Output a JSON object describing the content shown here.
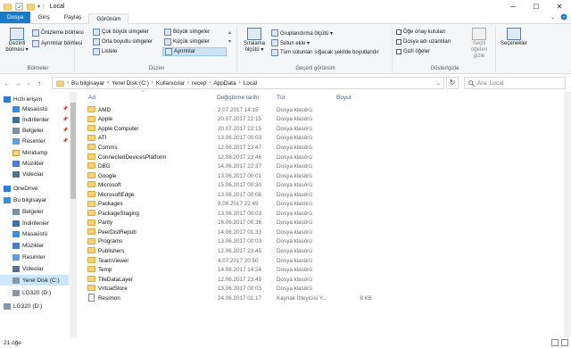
{
  "window": {
    "title": "Local",
    "controls": [
      "─",
      "☐",
      "✕"
    ]
  },
  "ribbon_tabs": {
    "file": "Dosya",
    "home": "Giriş",
    "share": "Paylaş",
    "view": "Görünüm"
  },
  "ribbon": {
    "panes": {
      "nav_pane": "Gezinti bölmesi ▾",
      "preview": "Önizleme bölmesi",
      "details": "Ayrıntılar bölmesi",
      "label": "Bölmeler"
    },
    "layout": {
      "extra_large": "Çok büyük simgeler",
      "large": "Büyük simgeler",
      "medium": "Orta boyutlu simgeler",
      "small": "Küçük simgeler",
      "list": "Listele",
      "details": "Ayrıntılar",
      "label": "Düzen"
    },
    "current_view": {
      "sort": "Sıralama ölçütü ▾",
      "group": "Gruplandırma ölçütü ▾",
      "add_columns": "Sütun ekle ▾",
      "fit_columns": "Tüm sütunları sığacak şekilde boyutlandır",
      "label": "Geçerli görünüm"
    },
    "show_hide": {
      "checkboxes": "Öğe onay kutuları",
      "extensions": "Dosya adı uzantıları",
      "hidden": "Gizli öğeler",
      "hide_selected": "Seçili öğeleri gizle",
      "label": "Göster/gizle"
    },
    "options": "Seçenekler"
  },
  "address": {
    "crumbs": [
      "Bu bilgisayar",
      "Yerel Disk (C:)",
      "Kullanıcılar",
      "recep",
      "AppData",
      "Local"
    ],
    "search_placeholder": "Ara: Local"
  },
  "nav": {
    "items": [
      {
        "label": "Hızlı erişim",
        "icon": "star-icon",
        "level": 0,
        "pinned": false
      },
      {
        "label": "Masaüstü",
        "icon": "desktop-icon",
        "level": 1,
        "pinned": true
      },
      {
        "label": "İndirilenler",
        "icon": "download-icon",
        "level": 1,
        "pinned": true
      },
      {
        "label": "Belgeler",
        "icon": "documents-icon",
        "level": 1,
        "pinned": true
      },
      {
        "label": "Resimler",
        "icon": "pictures-icon",
        "level": 1,
        "pinned": true
      },
      {
        "label": "Minidump",
        "icon": "folder-icon",
        "level": 1,
        "pinned": false
      },
      {
        "label": "Müzikler",
        "icon": "music-icon",
        "level": 1,
        "pinned": false
      },
      {
        "label": "Videolar",
        "icon": "videos-icon",
        "level": 1,
        "pinned": false
      },
      {
        "label": "OneDrive",
        "icon": "onedrive-icon",
        "level": 0,
        "pinned": false
      },
      {
        "label": "Bu bilgisayar",
        "icon": "computer-icon",
        "level": 0,
        "pinned": false
      },
      {
        "label": "Belgeler",
        "icon": "documents-icon",
        "level": 1,
        "pinned": false
      },
      {
        "label": "İndirilenler",
        "icon": "download-icon",
        "level": 1,
        "pinned": false
      },
      {
        "label": "Masaüstü",
        "icon": "desktop-icon",
        "level": 1,
        "pinned": false
      },
      {
        "label": "Müzikler",
        "icon": "music-icon",
        "level": 1,
        "pinned": false
      },
      {
        "label": "Resimler",
        "icon": "pictures-icon",
        "level": 1,
        "pinned": false
      },
      {
        "label": "Videolar",
        "icon": "videos-icon",
        "level": 1,
        "pinned": false
      },
      {
        "label": "Yerel Disk (C:)",
        "icon": "drive-icon",
        "level": 1,
        "pinned": false,
        "selected": true
      },
      {
        "label": "LG320 (D:)",
        "icon": "drive-icon",
        "level": 1,
        "pinned": false
      },
      {
        "label": "LG320 (D:)",
        "icon": "drive-icon",
        "level": 0,
        "pinned": false
      }
    ]
  },
  "columns": {
    "name": "Ad",
    "date": "Değiştirme tarihi",
    "type": "Tür",
    "size": "Boyut"
  },
  "files": [
    {
      "name": "AMD",
      "date": "2.07.2017 14:15",
      "type": "Dosya klasörü",
      "size": "",
      "kind": "folder"
    },
    {
      "name": "Apple",
      "date": "20.07.2017 22:15",
      "type": "Dosya klasörü",
      "size": "",
      "kind": "folder"
    },
    {
      "name": "Apple Computer",
      "date": "20.07.2017 22:15",
      "type": "Dosya klasörü",
      "size": "",
      "kind": "folder"
    },
    {
      "name": "ATI",
      "date": "13.06.2017 00:03",
      "type": "Dosya klasörü",
      "size": "",
      "kind": "folder"
    },
    {
      "name": "Comms",
      "date": "12.06.2017 23:47",
      "type": "Dosya klasörü",
      "size": "",
      "kind": "folder"
    },
    {
      "name": "ConnectedDevicesPlatform",
      "date": "12.06.2017 23:46",
      "type": "Dosya klasörü",
      "size": "",
      "kind": "folder"
    },
    {
      "name": "DBG",
      "date": "14.06.2017 22:37",
      "type": "Dosya klasörü",
      "size": "",
      "kind": "folder"
    },
    {
      "name": "Google",
      "date": "13.06.2017 00:01",
      "type": "Dosya klasörü",
      "size": "",
      "kind": "folder"
    },
    {
      "name": "Microsoft",
      "date": "15.06.2017 00:30",
      "type": "Dosya klasörü",
      "size": "",
      "kind": "folder"
    },
    {
      "name": "MicrosoftEdge",
      "date": "13.06.2017 00:08",
      "type": "Dosya klasörü",
      "size": "",
      "kind": "folder"
    },
    {
      "name": "Packages",
      "date": "8.08.2017 22:49",
      "type": "Dosya klasörü",
      "size": "",
      "kind": "folder"
    },
    {
      "name": "PackageStaging",
      "date": "13.06.2017 00:03",
      "type": "Dosya klasörü",
      "size": "",
      "kind": "folder"
    },
    {
      "name": "Parity",
      "date": "16.06.2017 00:36",
      "type": "Dosya klasörü",
      "size": "",
      "kind": "folder"
    },
    {
      "name": "PeerDistRepub",
      "date": "14.06.2017 01:33",
      "type": "Dosya klasörü",
      "size": "",
      "kind": "folder"
    },
    {
      "name": "Programs",
      "date": "13.06.2017 00:03",
      "type": "Dosya klasörü",
      "size": "",
      "kind": "folder"
    },
    {
      "name": "Publishers",
      "date": "12.06.2017 23:45",
      "type": "Dosya klasörü",
      "size": "",
      "kind": "folder"
    },
    {
      "name": "TeamViewer",
      "date": "4.07.2017 20:50",
      "type": "Dosya klasörü",
      "size": "",
      "kind": "folder"
    },
    {
      "name": "Temp",
      "date": "14.08.2017 14:24",
      "type": "Dosya klasörü",
      "size": "",
      "kind": "folder"
    },
    {
      "name": "TileDataLayer",
      "date": "12.06.2017 23:45",
      "type": "Dosya klasörü",
      "size": "",
      "kind": "folder"
    },
    {
      "name": "VirtualStore",
      "date": "13.06.2017 00:03",
      "type": "Dosya klasörü",
      "size": "",
      "kind": "folder"
    },
    {
      "name": "Resimon",
      "date": "24.06.2017 01:17",
      "type": "Kaynak İzleyicisi Y...",
      "size": "8 KB",
      "kind": "file"
    }
  ],
  "status": {
    "count": "21 öğe"
  },
  "colors": {
    "file_tab": "#1979ca",
    "selection": "#cce8ff",
    "folder": "#f7d37c"
  }
}
